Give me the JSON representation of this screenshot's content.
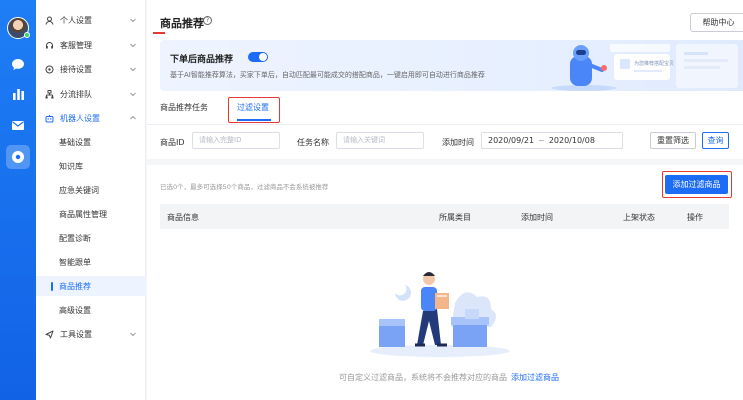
{
  "sidebar": {
    "items": [
      {
        "label": "个人设置",
        "icon": "user-icon"
      },
      {
        "label": "客服管理",
        "icon": "headset-icon"
      },
      {
        "label": "接待设置",
        "icon": "target-icon"
      },
      {
        "label": "分流排队",
        "icon": "flow-icon"
      },
      {
        "label": "机器人设置",
        "icon": "robot-icon"
      },
      {
        "label": "工具设置",
        "icon": "send-icon"
      }
    ],
    "sub_items": [
      "基础设置",
      "知识库",
      "应急关键词",
      "商品属性管理",
      "配置诊断",
      "智能跟单",
      "商品推荐",
      "高级设置"
    ]
  },
  "header": {
    "title": "商品推荐",
    "help_label": "帮助中心"
  },
  "banner": {
    "title": "下单后商品推荐",
    "description": "基于AI智能推荐算法，买家下单后，自动匹配最可能成交的搭配商品，一键启用即可自动进行商品推荐",
    "art_card_text": "为您推荐搭配宝贝",
    "toggle_on": true
  },
  "tabs": [
    {
      "label": "商品推荐任务",
      "active": false
    },
    {
      "label": "过滤设置",
      "active": true
    }
  ],
  "filters": {
    "product_id_label": "商品ID",
    "product_id_placeholder": "请输入完整ID",
    "task_name_label": "任务名称",
    "task_name_placeholder": "请输入关键词",
    "add_time_label": "添加时间",
    "date_start": "2020/09/21",
    "date_sep": "~",
    "date_end": "2020/10/08",
    "reset_label": "重置筛选",
    "query_label": "查询"
  },
  "list": {
    "hint": "已选0个，最多可选择50个商品，过滤商品不会系统被推荐",
    "add_button": "添加过滤商品",
    "columns": [
      "商品信息",
      "所属类目",
      "添加时间",
      "上架状态",
      "操作"
    ],
    "empty_text": "可自定义过滤商品，系统将不会推荐对应的商品",
    "empty_link": "添加过滤商品"
  },
  "colors": {
    "primary": "#1d6cf5",
    "highlight": "#e53935",
    "rail": "#1e7ef5"
  }
}
